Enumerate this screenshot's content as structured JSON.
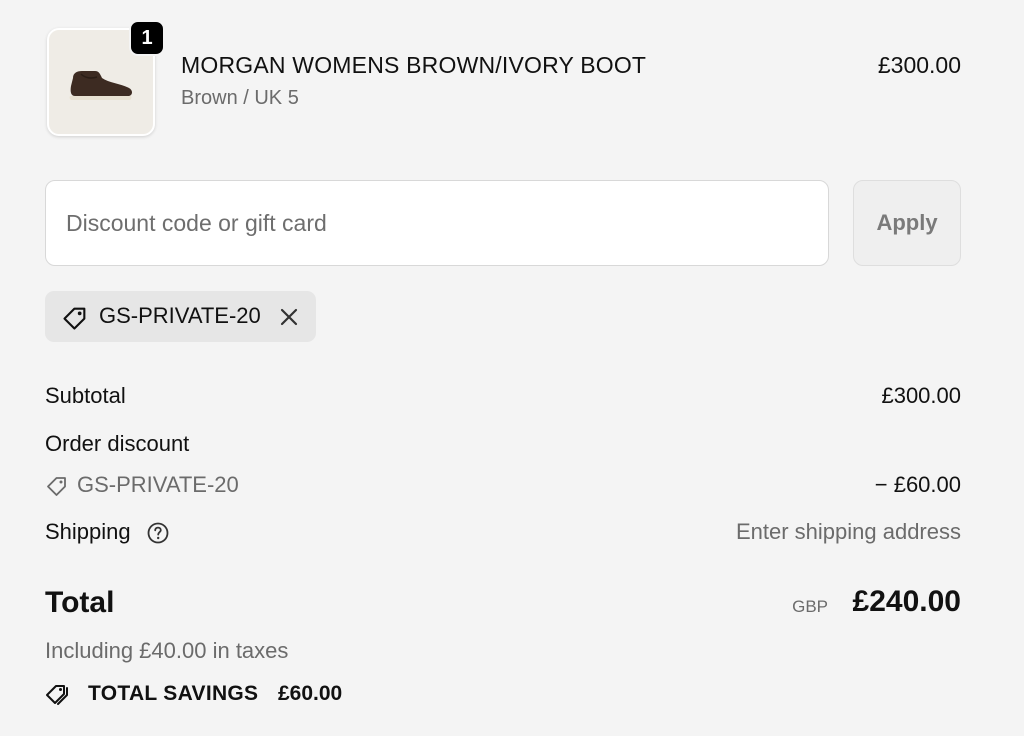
{
  "product": {
    "quantity": "1",
    "name": "MORGAN WOMENS BROWN/IVORY BOOT",
    "variant": "Brown / UK 5",
    "price": "£300.00",
    "image_icon": "brown-boot-image"
  },
  "discount": {
    "placeholder": "Discount code or gift card",
    "value": "",
    "apply_label": "Apply",
    "applied_code": "GS-PRIVATE-20"
  },
  "summary": {
    "subtotal_label": "Subtotal",
    "subtotal_value": "£300.00",
    "order_discount_label": "Order discount",
    "discount_code": "GS-PRIVATE-20",
    "discount_value": "− £60.00",
    "shipping_label": "Shipping",
    "shipping_value": "Enter shipping address",
    "total_label": "Total",
    "currency": "GBP",
    "total_value": "£240.00",
    "taxes_note": "Including £40.00 in taxes",
    "savings_label": "TOTAL SAVINGS",
    "savings_value": "£60.00"
  },
  "colors": {
    "background": "#f4f4f4",
    "text": "#111111",
    "muted_text": "#6b6b6b",
    "chip_bg": "#e6e6e6",
    "badge_bg": "#000000"
  }
}
